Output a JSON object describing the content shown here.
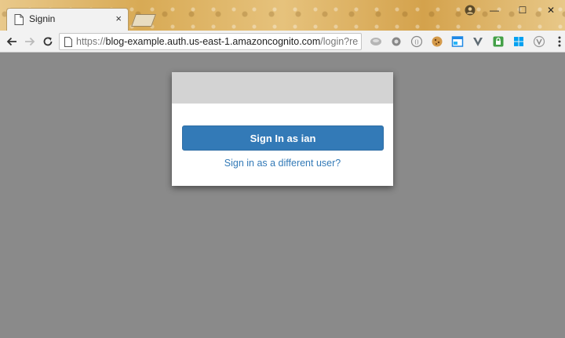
{
  "browser": {
    "tab": {
      "title": "Signin",
      "close_symbol": "×"
    },
    "window_controls": {
      "minimize": "—",
      "maximize": "☐",
      "close": "✕"
    },
    "address_bar": {
      "scheme": "https://",
      "host": "blog-example.auth.us-east-1.amazoncognito.com",
      "path": "/login?respon..."
    },
    "icons": {
      "back": "back-arrow-icon",
      "forward": "forward-arrow-icon",
      "reload": "reload-icon",
      "menu": "menu-dots-icon"
    }
  },
  "signin_modal": {
    "primary_button_label": "Sign In as ian",
    "secondary_link_label": "Sign in as a different user?",
    "colors": {
      "button": "#337ab7",
      "header": "#d3d3d3",
      "backdrop": "#8a8a8a"
    }
  }
}
